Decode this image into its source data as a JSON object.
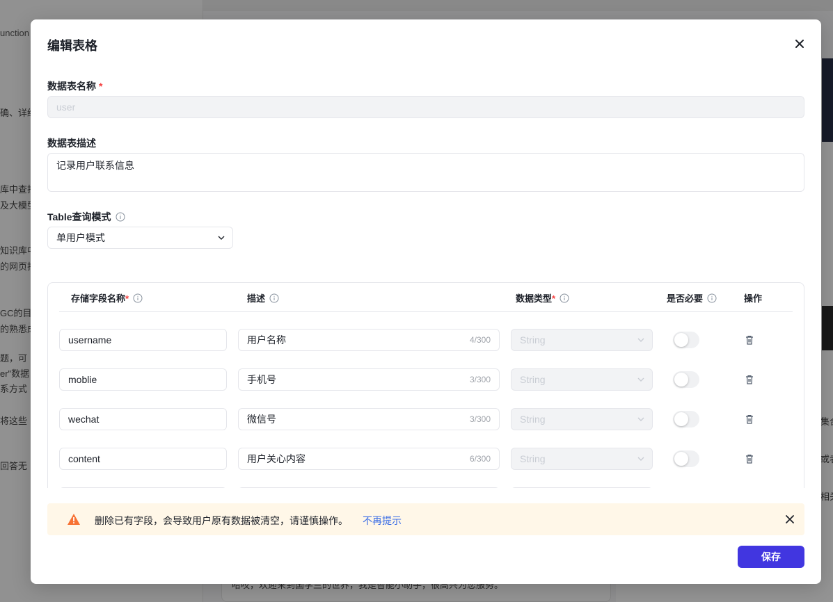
{
  "background": {
    "tab_label": "unction",
    "left_snippets": [
      "确、详细",
      "库中查找",
      "及大模型",
      "知识库中",
      "的网页找",
      "GC的目",
      "的熟悉成",
      "题，可",
      "er\"数据",
      "系方式",
      "将这些",
      "回答无"
    ],
    "bottom_text": "哈哎，欢迎来到国学兰的世界，我是智能小助手，很高兴为您服务。",
    "right_snippets": [
      "集合",
      "或者",
      "相关"
    ]
  },
  "modal": {
    "title": "编辑表格",
    "table_name_label": "数据表名称",
    "required_mark": "*",
    "table_name_value": "user",
    "table_desc_label": "数据表描述",
    "table_desc_value": "记录用户联系信息",
    "query_mode_label": "Table查询模式",
    "query_mode_value": "单用户模式",
    "columns": {
      "field_name": "存储字段名称",
      "description": "描述",
      "data_type": "数据类型",
      "required": "是否必要",
      "actions": "操作"
    },
    "rows": [
      {
        "name": "username",
        "desc": "用户名称",
        "count": "4/300",
        "type": "String",
        "required": false
      },
      {
        "name": "moblie",
        "desc": "手机号",
        "count": "3/300",
        "type": "String",
        "required": false
      },
      {
        "name": "wechat",
        "desc": "微信号",
        "count": "3/300",
        "type": "String",
        "required": false
      },
      {
        "name": "content",
        "desc": "用户关心内容",
        "count": "6/300",
        "type": "String",
        "required": false
      }
    ],
    "warning_text": "删除已有字段，会导致用户原有数据被清空，请谨慎操作。",
    "warning_link": "不再提示",
    "save_label": "保存"
  },
  "colors": {
    "primary": "#4136e0",
    "link": "#3b6ee6",
    "warning_bg": "#fff7e8",
    "warning_icon": "#f77234",
    "required": "#f53f3f"
  }
}
